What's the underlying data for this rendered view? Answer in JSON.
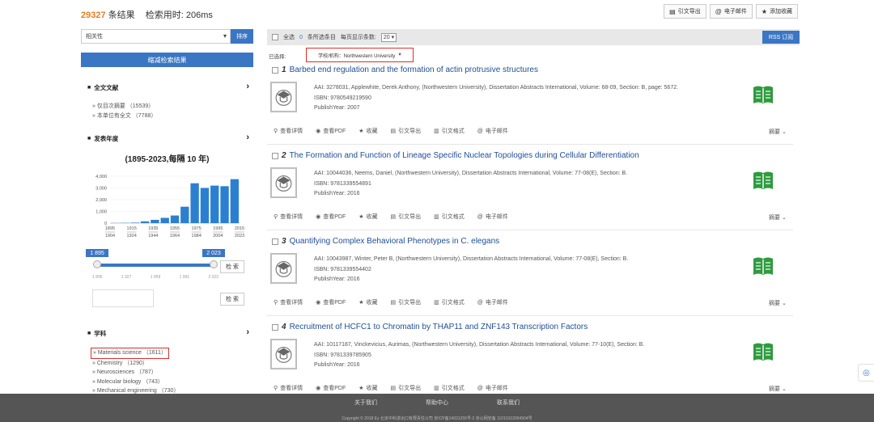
{
  "header": {
    "result_count": "29327",
    "result_suffix": "条结果",
    "time_label": "检索用时:",
    "time_value": "206ms",
    "buttons": [
      {
        "icon": "citation-icon",
        "glyph": "▤",
        "label": "引文导出"
      },
      {
        "icon": "email-icon",
        "glyph": "@",
        "label": "电子邮件"
      },
      {
        "icon": "star-icon",
        "glyph": "★",
        "label": "添加收藏"
      }
    ]
  },
  "sidebar": {
    "sort_value": "相关性",
    "sort_button": "排序",
    "narrow_button": "缩减检索结果",
    "fulltext": {
      "title": "全文文献",
      "items": [
        "» 仅目次摘要 （15539）",
        "» 本单位有全文 （7788）"
      ]
    },
    "pubyear": {
      "title": "发表年度",
      "range_title": "(1895-2023,每隔 10 年)",
      "start_label": "1 895",
      "end_label": "2 023",
      "ticks": [
        "1 895",
        "1 927",
        "1 959",
        "1 991",
        "2 023"
      ],
      "search_button": "检 索",
      "search_button_2": "检 索"
    },
    "subject": {
      "title": "学科",
      "items": [
        "» Materials science （1611）",
        "» Chemistry （1290）",
        "» Neurosciences （787）",
        "» Molecular biology （743）",
        "» Mechanical engineering （730）"
      ]
    }
  },
  "chart_data": {
    "type": "bar",
    "categories": [
      "1895-1904",
      "1905-1914",
      "1915-1924",
      "1925-1934",
      "1935-1944",
      "1945-1954",
      "1955-1964",
      "1965-1974",
      "1975-1984",
      "1985-1994",
      "1995-2004",
      "2005-2014",
      "2015-2023"
    ],
    "values": [
      10,
      20,
      40,
      150,
      280,
      450,
      650,
      1400,
      3400,
      3000,
      3200,
      3150,
      3750
    ],
    "ylim": [
      0,
      4000
    ],
    "y_ticks": [
      "0",
      "1,000",
      "2,000",
      "3,000",
      "4,000"
    ],
    "x_ticks_top": [
      "1895",
      "1915",
      "1935",
      "1955",
      "1975",
      "1995",
      "2015"
    ],
    "x_ticks_bottom": [
      "1904",
      "1924",
      "1944",
      "1964",
      "1984",
      "2004",
      "2023"
    ],
    "color": "#2b7fd0"
  },
  "main": {
    "toolbar": {
      "select_all": "全选",
      "selected_count": "0",
      "clear": "条所选条目",
      "per_page_label": "每页显示条数:",
      "per_page": "20 ▾",
      "rss": "RSS 订阅"
    },
    "selected_label": "已选择:",
    "filter_tag": "学校/机构：Northwestern University",
    "filter_close": "×",
    "actions": [
      {
        "icon": "search-icon",
        "glyph": "⚲",
        "label": "查看详情"
      },
      {
        "icon": "eye-icon",
        "glyph": "◉",
        "label": "查看PDF"
      },
      {
        "icon": "star-icon",
        "glyph": "★",
        "label": "收藏"
      },
      {
        "icon": "cite-export-icon",
        "glyph": "▤",
        "label": "引文导出"
      },
      {
        "icon": "cite-format-icon",
        "glyph": "▥",
        "label": "引文格式"
      },
      {
        "icon": "email-icon",
        "glyph": "@",
        "label": "电子邮件"
      }
    ],
    "abstract_label": "摘要 ⌄",
    "records": [
      {
        "num": "1",
        "title": "Barbed end regulation and the formation of actin protrusive structures",
        "aai": "AAI: 3278031, Applewhite, Derek Anthony, (Northwestern University), Dissertation Abstracts International, Volume: 68-09, Section: B, page: 5672.",
        "isbn": "ISBN: 9780549219590",
        "year": "PublishYear: 2007"
      },
      {
        "num": "2",
        "title": "The Formation and Function of Lineage Specific Nuclear Topologies during Cellular Differentiation",
        "aai": "AAI: 10044036, Neems, Daniel, (Northwestern University), Dissertation Abstracts International, Volume: 77-08(E), Section: B.",
        "isbn": "ISBN: 9781339554891",
        "year": "PublishYear: 2016"
      },
      {
        "num": "3",
        "title": "Quantifying Complex Behavioral Phenotypes in C. elegans",
        "aai": "AAI: 10043987, Winter, Peter B, (Northwestern University), Dissertation Abstracts International, Volume: 77-08(E), Section: B.",
        "isbn": "ISBN: 9781339554402",
        "year": "PublishYear: 2016"
      },
      {
        "num": "4",
        "title": "Recruitment of HCFC1 to Chromatin by THAP11 and ZNF143 Transcription Factors",
        "aai": "AAI: 10117187, Vinckevicius, Aurimas, (Northwestern University), Dissertation Abstracts International, Volume: 77-10(E), Section: B.",
        "isbn": "ISBN: 9781339785905",
        "year": "PublishYear: 2016"
      }
    ]
  },
  "footer": {
    "links": [
      "关于我们",
      "帮助中心",
      "联系我们"
    ],
    "copyright": "Copyright © 2018 Ey 北京中科进出口有限责任公司 京ICP备14031255号-2 京公网安备 11010102004504号"
  },
  "colors": {
    "accent": "#3a76c4",
    "count": "#e67e22",
    "highlight": "#d9302c",
    "book_green": "#2e9b3f"
  }
}
